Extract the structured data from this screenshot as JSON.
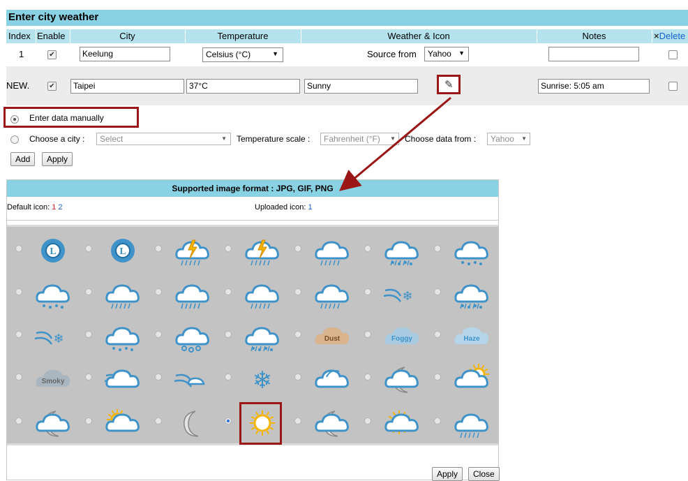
{
  "title": "Enter city weather",
  "columns": {
    "index": "Index",
    "enable": "Enable",
    "city": "City",
    "temperature": "Temperature",
    "weather_icon": "Weather & Icon",
    "notes": "Notes",
    "delete": "Delete",
    "delete_icon": "×"
  },
  "row1": {
    "index": "1",
    "enabled": true,
    "city": "Keelung",
    "temp_unit": "Celsius (°C)",
    "source_label": "Source from",
    "source": "Yahoo",
    "notes": ""
  },
  "row2": {
    "index": "NEW.",
    "enabled": true,
    "city": "Taipei",
    "temperature": "37°C",
    "weather": "Sunny",
    "notes": "Sunrise: 5:05 am"
  },
  "options": {
    "manual_label": "Enter data manually",
    "manual_selected": true,
    "choose_city_label": "Choose a city :",
    "city_placeholder": "Select",
    "temp_scale_label": "Temperature scale :",
    "temp_scale": "Fahrenheit (°F)",
    "data_from_label": "Choose data from :",
    "data_from": "Yahoo",
    "add_label": "Add",
    "apply_label": "Apply"
  },
  "icon_panel": {
    "header": "Supported image format : JPG, GIF, PNG",
    "default_icon_label": "Default icon:",
    "default_icon_1": "1",
    "default_icon_2": "2",
    "uploaded_icon_label": "Uploaded icon:",
    "uploaded_icon_1": "1",
    "apply_label": "Apply",
    "close_label": "Close",
    "selected_icon": "sunny",
    "icon_text": {
      "dust": "Dust",
      "foggy": "Foggy",
      "haze": "Haze",
      "smoky": "Smoky",
      "hurricane": "L"
    }
  },
  "colors": {
    "header_bg": "#89d2e3",
    "column_header_bg": "#b4e3ee",
    "highlight": "#9b1616",
    "link": "#1a5fd0",
    "red_text": "#d21d1d",
    "cloud": "#3f93c9",
    "sun": "#f4b400"
  }
}
